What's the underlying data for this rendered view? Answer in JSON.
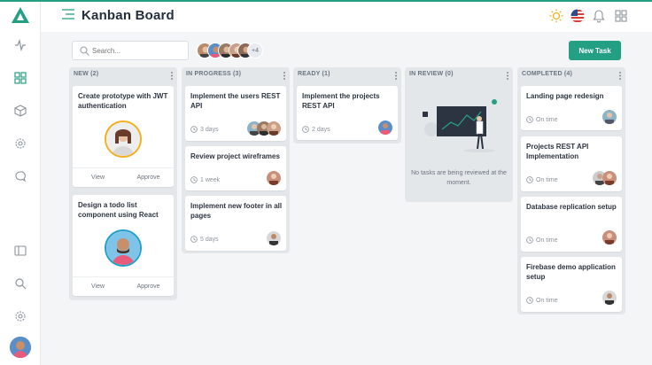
{
  "header": {
    "title": "Kanban Board"
  },
  "search": {
    "placeholder": "Search..."
  },
  "team": {
    "more": "+4"
  },
  "toolbar": {
    "new_task": "New Task"
  },
  "columns": [
    {
      "title": "NEW (2)"
    },
    {
      "title": "IN PROGRESS (3)"
    },
    {
      "title": "READY (1)"
    },
    {
      "title": "IN REVIEW (0)"
    },
    {
      "title": "COMPLETED (4)"
    }
  ],
  "cards": {
    "new": [
      {
        "title": "Create prototype with JWT authentication",
        "view": "View",
        "approve": "Approve"
      },
      {
        "title": "Design a todo list component using React",
        "view": "View",
        "approve": "Approve"
      }
    ],
    "progress": [
      {
        "title": "Implement the users REST API",
        "meta": "3 days"
      },
      {
        "title": "Review project wireframes",
        "meta": "1 week"
      },
      {
        "title": "Implement new footer in all pages",
        "meta": "5 days"
      }
    ],
    "ready": [
      {
        "title": "Implement the projects REST API",
        "meta": "2 days"
      }
    ],
    "review": {
      "empty": "No tasks are being reviewed at the moment."
    },
    "completed": [
      {
        "title": "Landing page redesign",
        "meta": "On time"
      },
      {
        "title": "Projects REST API Implementation",
        "meta": "On time"
      },
      {
        "title": "Database replication setup",
        "meta": "On time"
      },
      {
        "title": "Firebase demo application setup",
        "meta": "On time"
      }
    ]
  },
  "colors": {
    "accent": "#23a084",
    "flag": "#d93b3b",
    "sun": "#f2b01e"
  }
}
